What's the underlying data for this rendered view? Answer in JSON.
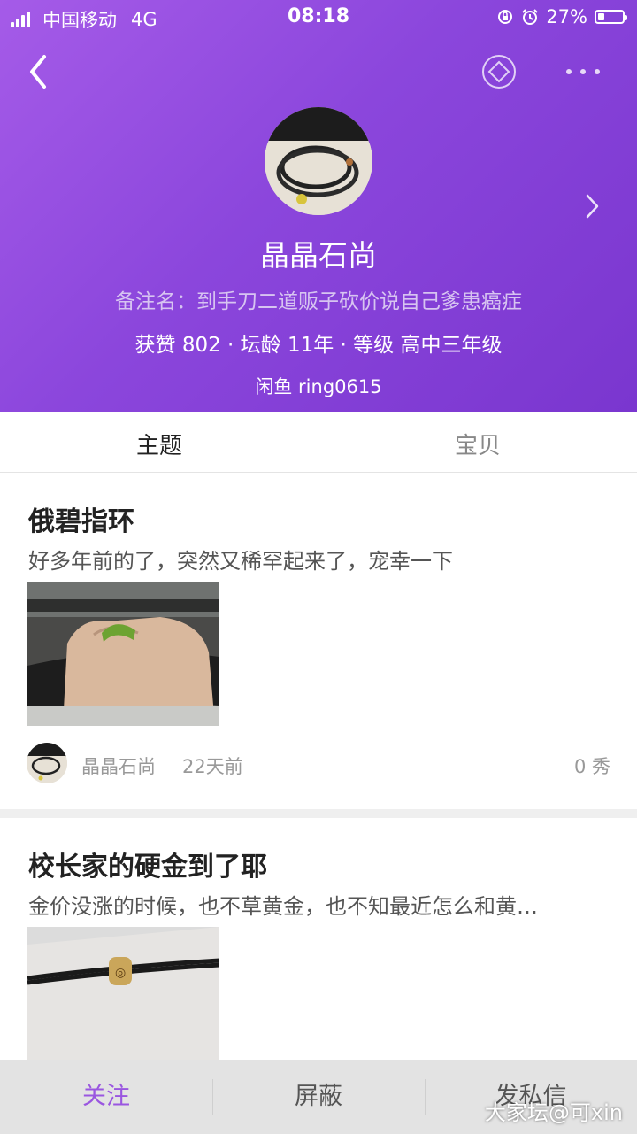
{
  "status_bar": {
    "carrier": "中国移动",
    "network": "4G",
    "time": "08:18",
    "battery": "27%",
    "battery_level": 0.27
  },
  "header": {
    "icons": [
      "back-arrow-icon",
      "medal-icon",
      "more-dots-icon",
      "chevron-right-icon"
    ]
  },
  "profile": {
    "nickname": "晶晶石尚",
    "remark": "备注名：到手刀二道贩子砍价说自己爹患癌症",
    "stats": "获赞 802 · 坛龄 11年 · 等级 高中三年级",
    "signature": "闲鱼 ring0615"
  },
  "tabs": [
    {
      "label": "主题",
      "active": true
    },
    {
      "label": "宝贝",
      "active": false
    }
  ],
  "posts": [
    {
      "title": "俄碧指环",
      "excerpt": "好多年前的了，突然又稀罕起来了，宠幸一下",
      "author": "晶晶石尚",
      "time": "22天前",
      "count": "0 秀"
    },
    {
      "title": "校长家的硬金到了耶",
      "excerpt": "金价没涨的时候，也不草黄金，也不知最近怎么和黄…"
    }
  ],
  "bottom_bar": {
    "follow": "关注",
    "block": "屏蔽",
    "message": "发私信"
  },
  "watermark": "大家坛@可xin",
  "colors": {
    "header_gradient_start": "#a55be8",
    "header_gradient_end": "#7a36cf",
    "accent": "#9a56e0"
  }
}
